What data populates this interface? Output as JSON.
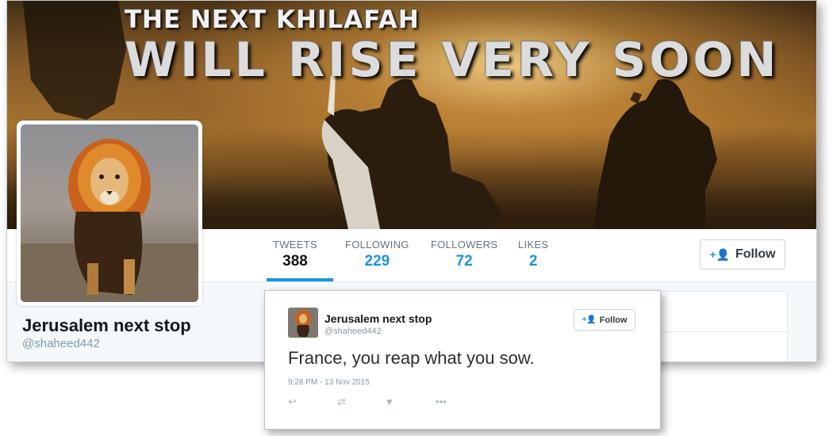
{
  "banner": {
    "line1": "THE NEXT KHILAFAH",
    "line2": "WILL RISE VERY SOON"
  },
  "profile": {
    "display_name": "Jerusalem next stop",
    "handle": "@shaheed442",
    "avatar_icon": "lion-icon"
  },
  "stats": [
    {
      "label": "TWEETS",
      "value": "388"
    },
    {
      "label": "FOLLOWING",
      "value": "229"
    },
    {
      "label": "FOLLOWERS",
      "value": "72"
    },
    {
      "label": "LIKES",
      "value": "2"
    }
  ],
  "follow_button": {
    "label": "Follow",
    "icon": "person-plus-icon"
  },
  "tweet": {
    "name": "Jerusalem next stop",
    "handle": "@shaheed442",
    "follow_label": "Follow",
    "text": "France, you reap what you sow.",
    "timestamp": "9:28 PM - 13 Nov 2015",
    "actions": [
      "reply-icon",
      "retweet-icon",
      "like-icon",
      "more-icon"
    ]
  },
  "colors": {
    "accent": "#1b95e0",
    "text_dark": "#14171a",
    "text_muted": "#8899a6"
  }
}
